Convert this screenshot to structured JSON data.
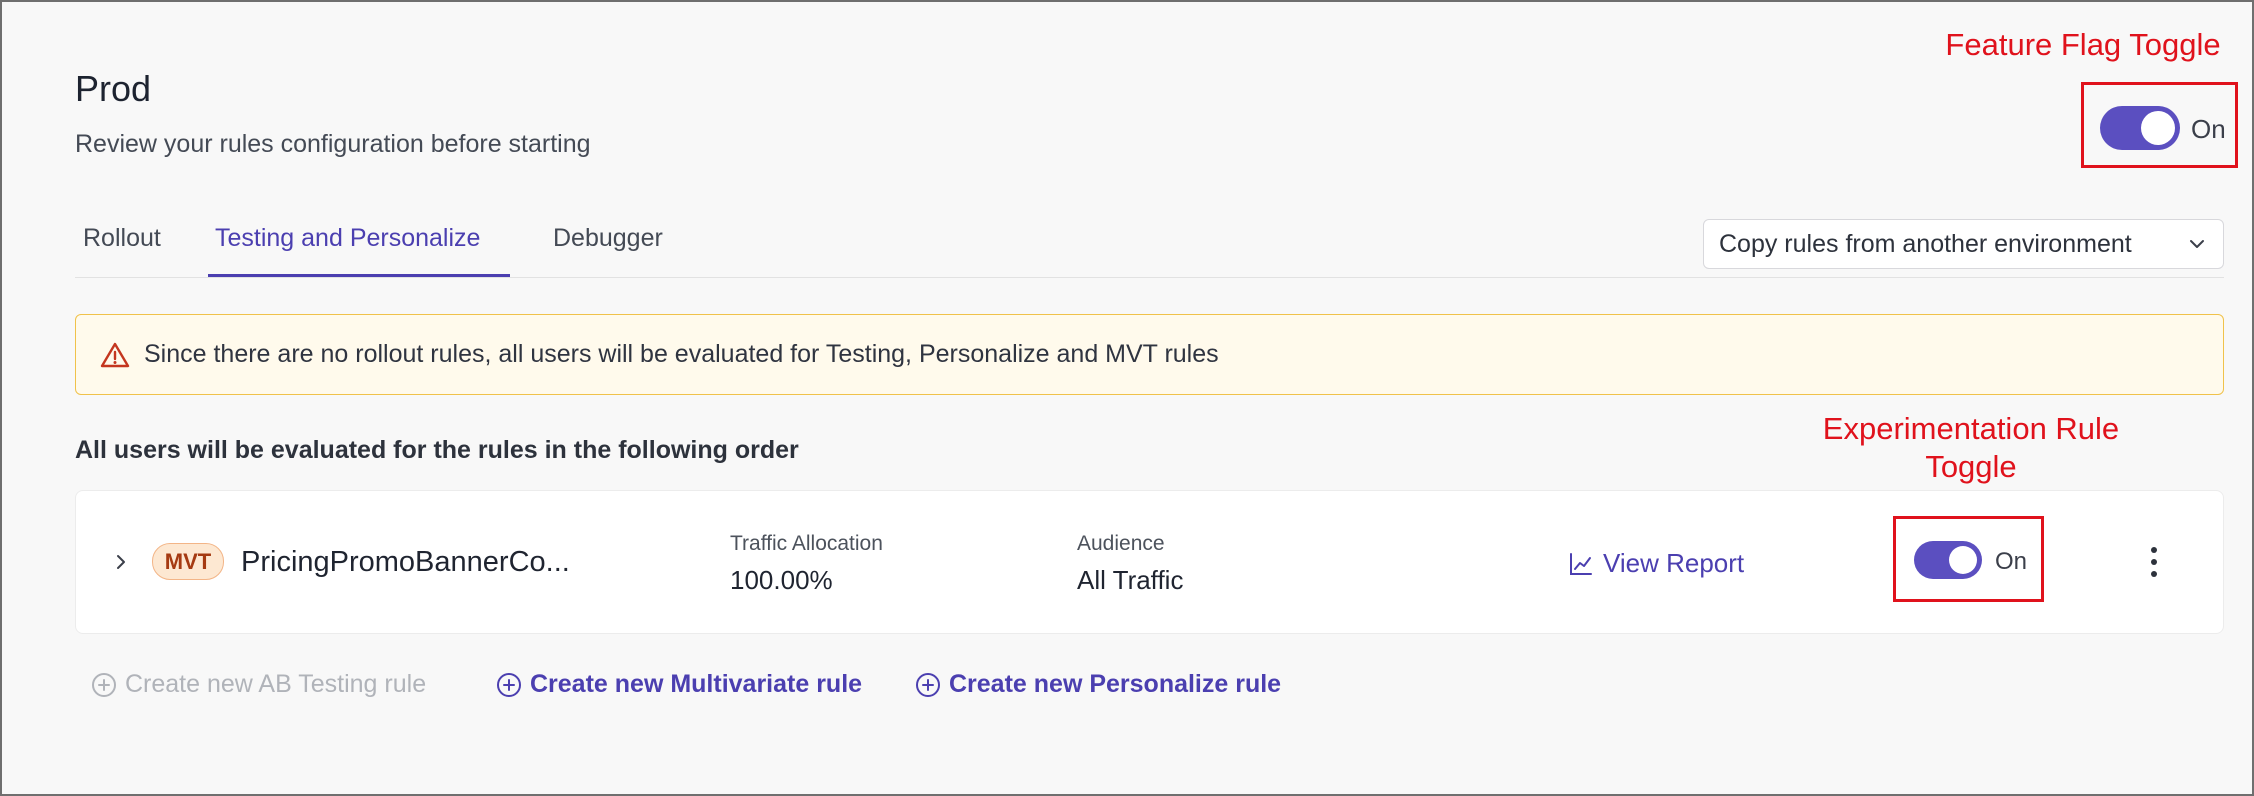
{
  "header": {
    "title": "Prod",
    "subtitle": "Review your rules configuration before starting"
  },
  "annotations": {
    "feature_flag": "Feature Flag Toggle",
    "experimentation_rule": "Experimentation Rule Toggle"
  },
  "feature_flag_toggle": {
    "label": "On",
    "state": true
  },
  "tabs": [
    {
      "label": "Rollout",
      "active": false
    },
    {
      "label": "Testing and Personalize",
      "active": true
    },
    {
      "label": "Debugger",
      "active": false
    }
  ],
  "copy_rules": {
    "label": "Copy rules from another environment"
  },
  "warning": {
    "icon": "warning-triangle-icon",
    "text": "Since there are no rollout rules, all users will be evaluated for Testing, Personalize and MVT rules"
  },
  "order_text": "All users will be evaluated for the rules in the following order",
  "rule": {
    "badge": "MVT",
    "name": "PricingPromoBannerCo...",
    "traffic_allocation_label": "Traffic Allocation",
    "traffic_allocation_value": "100.00%",
    "audience_label": "Audience",
    "audience_value": "All Traffic",
    "view_report": "View Report",
    "toggle_label": "On",
    "toggle_state": true
  },
  "create_links": {
    "ab_testing": "Create new AB Testing rule",
    "multivariate": "Create new Multivariate rule",
    "personalize": "Create new Personalize rule"
  },
  "colors": {
    "accent": "#4b3fb0",
    "toggle": "#5b4fc0",
    "annotation": "#e0121c",
    "warning_border": "#f0c24a",
    "warning_bg": "#fffaec",
    "badge_bg": "#fde8d2",
    "badge_text": "#a53a12"
  }
}
